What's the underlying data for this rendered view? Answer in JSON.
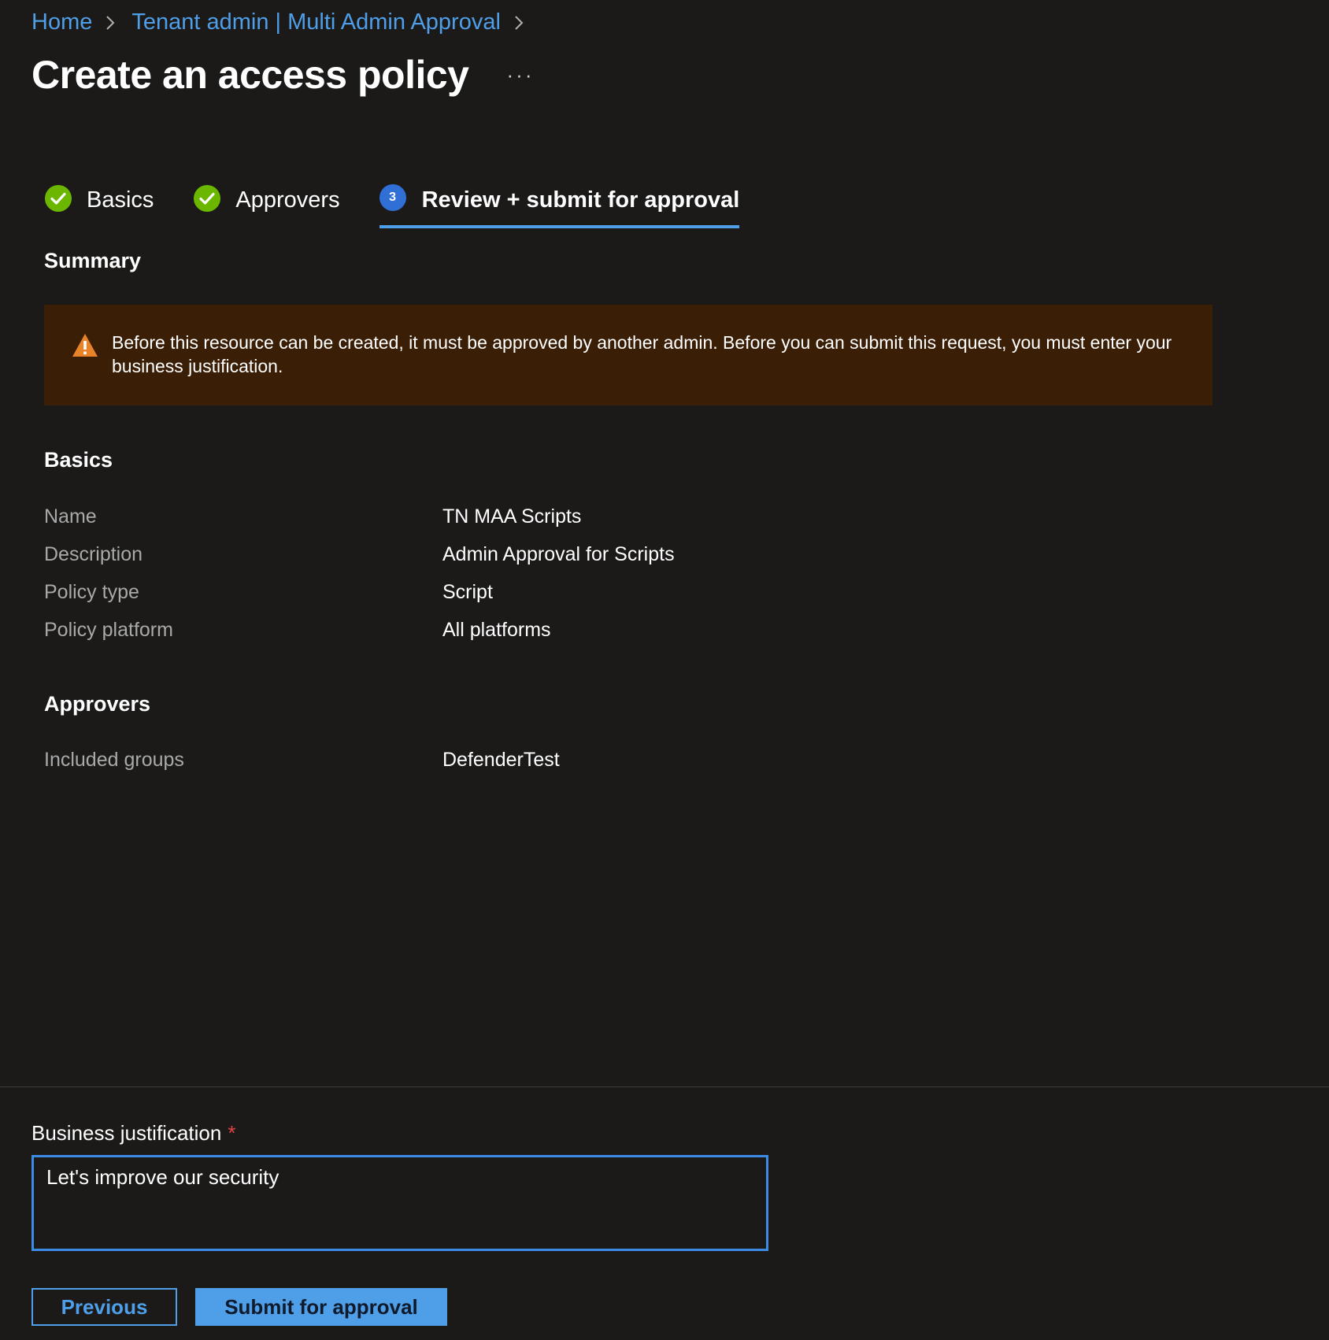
{
  "breadcrumb": {
    "items": [
      "Home",
      "Tenant admin | Multi Admin Approval"
    ]
  },
  "page": {
    "title": "Create an access policy",
    "more_label": "···"
  },
  "tabs": [
    {
      "label": "Basics",
      "state": "complete"
    },
    {
      "label": "Approvers",
      "state": "complete"
    },
    {
      "label": "Review + submit for approval",
      "state": "active",
      "step": "3"
    }
  ],
  "summary": {
    "heading": "Summary",
    "warning": "Before this resource can be created, it must be approved by another admin. Before you can submit this request, you must enter your business justification."
  },
  "basics": {
    "heading": "Basics",
    "rows": [
      {
        "label": "Name",
        "value": "TN MAA Scripts"
      },
      {
        "label": "Description",
        "value": "Admin Approval for Scripts"
      },
      {
        "label": "Policy type",
        "value": "Script"
      },
      {
        "label": "Policy platform",
        "value": "All platforms"
      }
    ]
  },
  "approvers": {
    "heading": "Approvers",
    "rows": [
      {
        "label": "Included groups",
        "value": "DefenderTest"
      }
    ]
  },
  "justification": {
    "label": "Business justification",
    "required_mark": "*",
    "value": "Let's improve our security"
  },
  "buttons": {
    "previous": "Previous",
    "submit": "Submit for approval"
  },
  "colors": {
    "accent": "#4f9ee8",
    "success": "#6bb700",
    "warning_bg": "#3a1e06",
    "warning_icon": "#e8832a",
    "background": "#1b1a19"
  }
}
